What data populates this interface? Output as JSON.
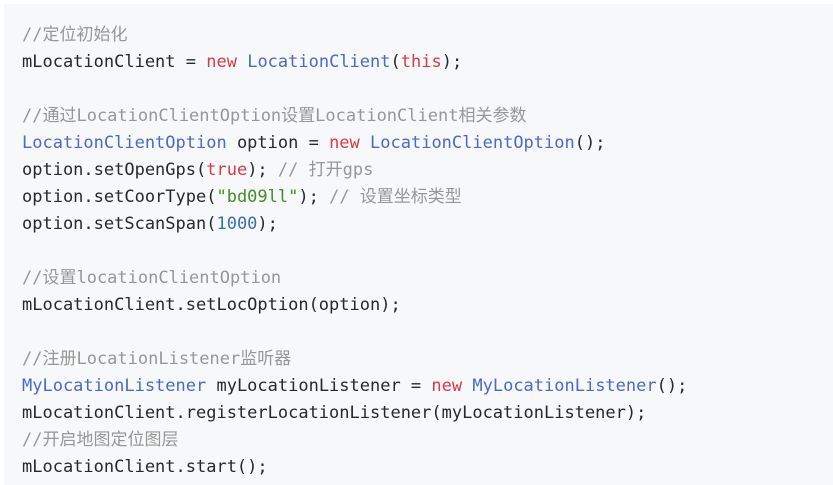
{
  "colors": {
    "background": "#f6f8fa",
    "plain": "#24292e",
    "comment": "#969896",
    "keyword": "#d73a49",
    "type": "#4b69c6",
    "string": "#448c27",
    "number": "#3b6db2"
  },
  "lines": [
    [
      {
        "t": "//定位初始化",
        "k": "comment"
      }
    ],
    [
      {
        "t": "mLocationClient = ",
        "k": "plain"
      },
      {
        "t": "new",
        "k": "keyword"
      },
      {
        "t": " ",
        "k": "plain"
      },
      {
        "t": "LocationClient",
        "k": "type"
      },
      {
        "t": "(",
        "k": "plain"
      },
      {
        "t": "this",
        "k": "keyword"
      },
      {
        "t": ");",
        "k": "plain"
      }
    ],
    [],
    [
      {
        "t": "//通过LocationClientOption设置LocationClient相关参数",
        "k": "comment"
      }
    ],
    [
      {
        "t": "LocationClientOption",
        "k": "type"
      },
      {
        "t": " option = ",
        "k": "plain"
      },
      {
        "t": "new",
        "k": "keyword"
      },
      {
        "t": " ",
        "k": "plain"
      },
      {
        "t": "LocationClientOption",
        "k": "type"
      },
      {
        "t": "();",
        "k": "plain"
      }
    ],
    [
      {
        "t": "option.setOpenGps(",
        "k": "plain"
      },
      {
        "t": "true",
        "k": "keyword"
      },
      {
        "t": "); ",
        "k": "plain"
      },
      {
        "t": "// 打开gps",
        "k": "comment"
      }
    ],
    [
      {
        "t": "option.setCoorType(",
        "k": "plain"
      },
      {
        "t": "\"bd09ll\"",
        "k": "string"
      },
      {
        "t": "); ",
        "k": "plain"
      },
      {
        "t": "// 设置坐标类型",
        "k": "comment"
      }
    ],
    [
      {
        "t": "option.setScanSpan(",
        "k": "plain"
      },
      {
        "t": "1000",
        "k": "number"
      },
      {
        "t": ");",
        "k": "plain"
      }
    ],
    [],
    [
      {
        "t": "//设置locationClientOption",
        "k": "comment"
      }
    ],
    [
      {
        "t": "mLocationClient.setLocOption(option);",
        "k": "plain"
      }
    ],
    [],
    [
      {
        "t": "//注册LocationListener监听器",
        "k": "comment"
      }
    ],
    [
      {
        "t": "MyLocationListener",
        "k": "type"
      },
      {
        "t": " myLocationListener = ",
        "k": "plain"
      },
      {
        "t": "new",
        "k": "keyword"
      },
      {
        "t": " ",
        "k": "plain"
      },
      {
        "t": "MyLocationListener",
        "k": "type"
      },
      {
        "t": "();",
        "k": "plain"
      }
    ],
    [
      {
        "t": "mLocationClient.registerLocationListener(myLocationListener);",
        "k": "plain"
      }
    ],
    [
      {
        "t": "//开启地图定位图层",
        "k": "comment"
      }
    ],
    [
      {
        "t": "mLocationClient.start();",
        "k": "plain"
      }
    ]
  ]
}
